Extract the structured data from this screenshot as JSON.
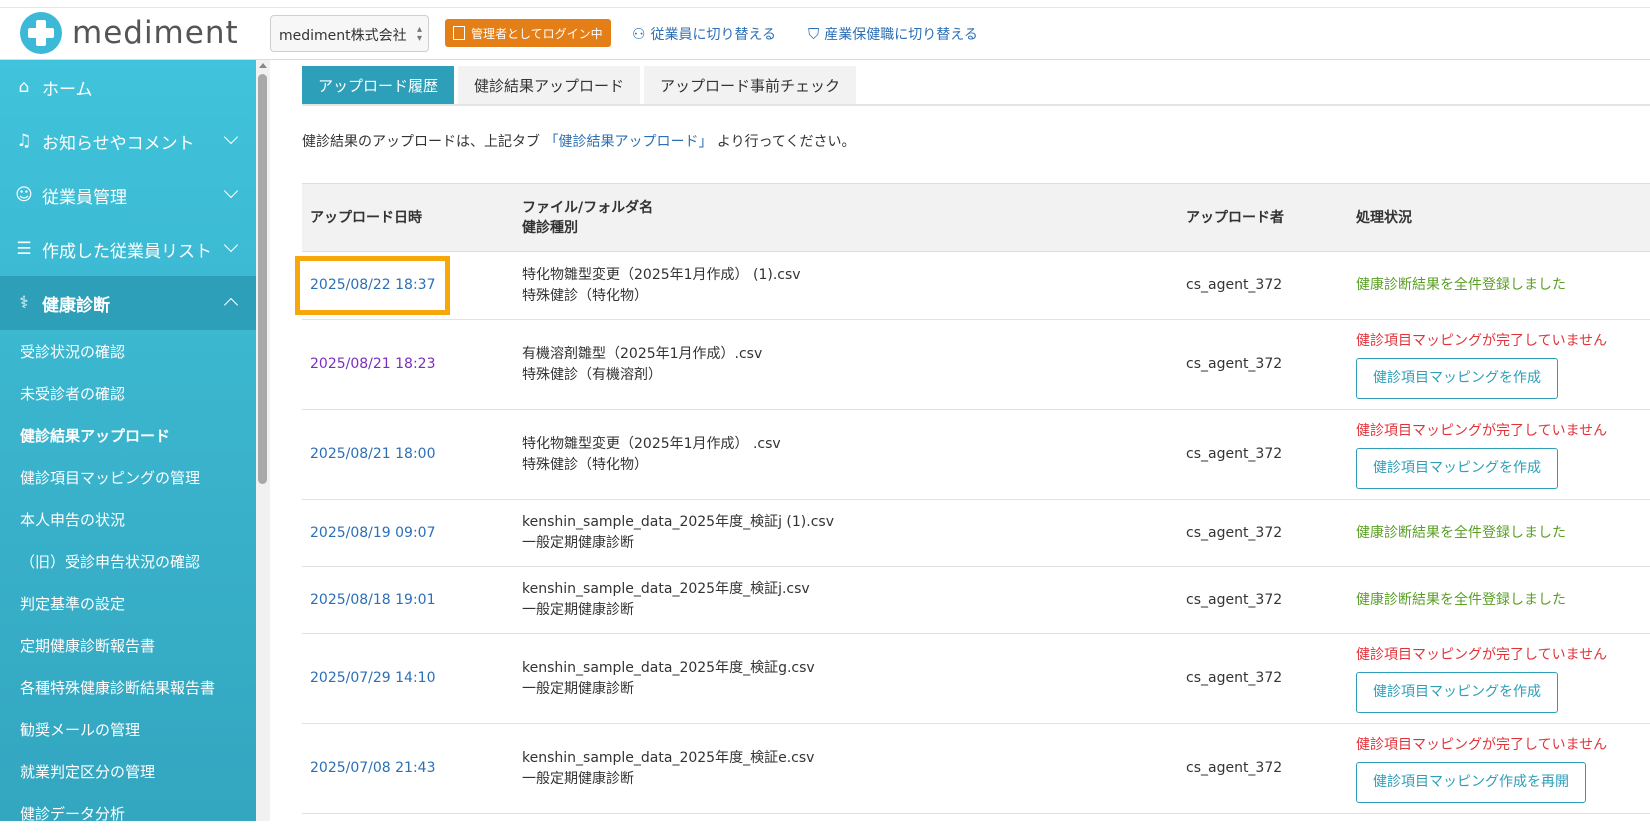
{
  "app": {
    "logo_text": "mediment",
    "brand_color": "#3bb9d6"
  },
  "header": {
    "company_select_value": "mediment株式会社",
    "admin_badge": "管理者としてログイン中",
    "switch_employee": "従業員に切り替える",
    "switch_health_staff": "産業保健職に切り替える"
  },
  "sidebar": {
    "main_items": [
      {
        "label": "ホーム",
        "icon": "home-icon"
      },
      {
        "label": "お知らせやコメント",
        "icon": "bell-icon"
      },
      {
        "label": "従業員管理",
        "icon": "people-icon"
      },
      {
        "label": "作成した従業員リスト",
        "icon": "user-list-icon"
      },
      {
        "label": "健康診断",
        "icon": "stethoscope-icon"
      }
    ],
    "sub_items": [
      "受診状況の確認",
      "未受診者の確認",
      "健診結果アップロード",
      "健診項目マッピングの管理",
      "本人申告の状況",
      "（旧）受診申告状況の確認",
      "判定基準の設定",
      "定期健康診断報告書",
      "各種特殊健康診断結果報告書",
      "勧奨メールの管理",
      "就業判定区分の管理",
      "健診データ分析"
    ]
  },
  "tabs": [
    "アップロード履歴",
    "健診結果アップロード",
    "アップロード事前チェック"
  ],
  "info": {
    "prefix": "健診結果のアップロードは、上記タブ",
    "link": "「健診結果アップロード」",
    "suffix": "より行ってください。"
  },
  "table": {
    "headers": {
      "datetime": "アップロード日時",
      "file": "ファイル/フォルダ名",
      "type": "健診種別",
      "uploader": "アップロード者",
      "status": "処理状況"
    },
    "rows": [
      {
        "datetime": "2025/08/22 18:37",
        "file": "特化物雛型変更（2025年1月作成） (1).csv",
        "type": "特殊健診（特化物）",
        "uploader": "cs_agent_372",
        "status": "健康診断結果を全件登録しました",
        "ok": true,
        "button": ""
      },
      {
        "datetime": "2025/08/21 18:23",
        "file": "有機溶剤雛型（2025年1月作成）.csv",
        "type": "特殊健診（有機溶剤）",
        "uploader": "cs_agent_372",
        "status": "健診項目マッピングが完了していません",
        "ok": false,
        "button": "健診項目マッピングを作成"
      },
      {
        "datetime": "2025/08/21 18:00",
        "file": "特化物雛型変更（2025年1月作成） .csv",
        "type": "特殊健診（特化物）",
        "uploader": "cs_agent_372",
        "status": "健診項目マッピングが完了していません",
        "ok": false,
        "button": "健診項目マッピングを作成"
      },
      {
        "datetime": "2025/08/19 09:07",
        "file": "kenshin_sample_data_2025年度_検証j (1).csv",
        "type": "一般定期健康診断",
        "uploader": "cs_agent_372",
        "status": "健康診断結果を全件登録しました",
        "ok": true,
        "button": ""
      },
      {
        "datetime": "2025/08/18 19:01",
        "file": "kenshin_sample_data_2025年度_検証j.csv",
        "type": "一般定期健康診断",
        "uploader": "cs_agent_372",
        "status": "健康診断結果を全件登録しました",
        "ok": true,
        "button": ""
      },
      {
        "datetime": "2025/07/29 14:10",
        "file": "kenshin_sample_data_2025年度_検証g.csv",
        "type": "一般定期健康診断",
        "uploader": "cs_agent_372",
        "status": "健診項目マッピングが完了していません",
        "ok": false,
        "button": "健診項目マッピングを作成"
      },
      {
        "datetime": "2025/07/08 21:43",
        "file": "kenshin_sample_data_2025年度_検証e.csv",
        "type": "一般定期健康診断",
        "uploader": "cs_agent_372",
        "status": "健診項目マッピングが完了していません",
        "ok": false,
        "button": "健診項目マッピング作成を再開"
      }
    ]
  },
  "colors": {
    "status_ok": "#5aa025",
    "status_ng": "#e2333a",
    "highlight": "#f7a70a",
    "accent": "#2d9fb9"
  }
}
